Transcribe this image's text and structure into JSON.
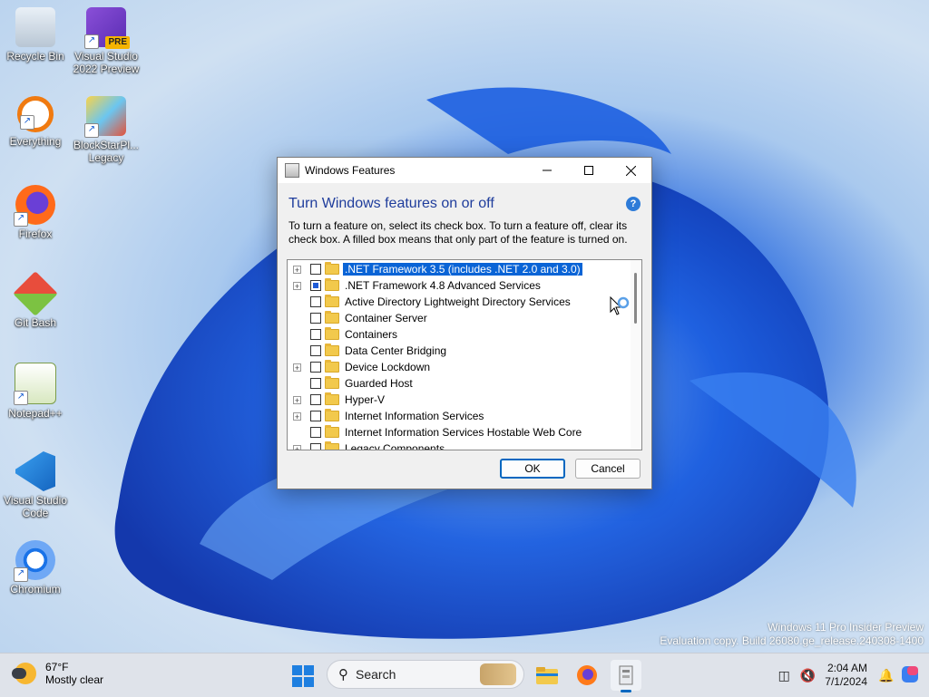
{
  "desktop": {
    "icons": [
      {
        "label": "Recycle Bin"
      },
      {
        "label": "Visual Studio 2022 Preview",
        "badge": "PRE"
      },
      {
        "label": "Everything"
      },
      {
        "label": "BlockStarPl... Legacy"
      },
      {
        "label": "Firefox"
      },
      {
        "label": "Git Bash"
      },
      {
        "label": "Notepad++"
      },
      {
        "label": "Visual Studio Code"
      },
      {
        "label": "Chromium"
      }
    ],
    "watermark": {
      "line1": "Windows 11 Pro Insider Preview",
      "line2": "Evaluation copy. Build 26080.ge_release.240308-1400"
    }
  },
  "dialog": {
    "title": "Windows Features",
    "heading": "Turn Windows features on or off",
    "help_symbol": "?",
    "description": "To turn a feature on, select its check box. To turn a feature off, clear its check box. A filled box means that only part of the feature is turned on.",
    "features": [
      {
        "label": ".NET Framework 3.5 (includes .NET 2.0 and 3.0)",
        "expandable": true,
        "state": "unchecked",
        "selected": true
      },
      {
        "label": ".NET Framework 4.8 Advanced Services",
        "expandable": true,
        "state": "partial",
        "selected": false
      },
      {
        "label": "Active Directory Lightweight Directory Services",
        "expandable": false,
        "state": "unchecked",
        "selected": false
      },
      {
        "label": "Container Server",
        "expandable": false,
        "state": "unchecked",
        "selected": false
      },
      {
        "label": "Containers",
        "expandable": false,
        "state": "unchecked",
        "selected": false
      },
      {
        "label": "Data Center Bridging",
        "expandable": false,
        "state": "unchecked",
        "selected": false
      },
      {
        "label": "Device Lockdown",
        "expandable": true,
        "state": "unchecked",
        "selected": false
      },
      {
        "label": "Guarded Host",
        "expandable": false,
        "state": "unchecked",
        "selected": false
      },
      {
        "label": "Hyper-V",
        "expandable": true,
        "state": "unchecked",
        "selected": false
      },
      {
        "label": "Internet Information Services",
        "expandable": true,
        "state": "unchecked",
        "selected": false
      },
      {
        "label": "Internet Information Services Hostable Web Core",
        "expandable": false,
        "state": "unchecked",
        "selected": false
      },
      {
        "label": "Legacy Components",
        "expandable": true,
        "state": "unchecked",
        "selected": false
      }
    ],
    "ok_label": "OK",
    "cancel_label": "Cancel"
  },
  "taskbar": {
    "weather": {
      "temp": "67°F",
      "condition": "Mostly clear"
    },
    "search_placeholder": "Search",
    "clock": {
      "time": "2:04 AM",
      "date": "7/1/2024"
    },
    "accent": "#0067c0"
  }
}
